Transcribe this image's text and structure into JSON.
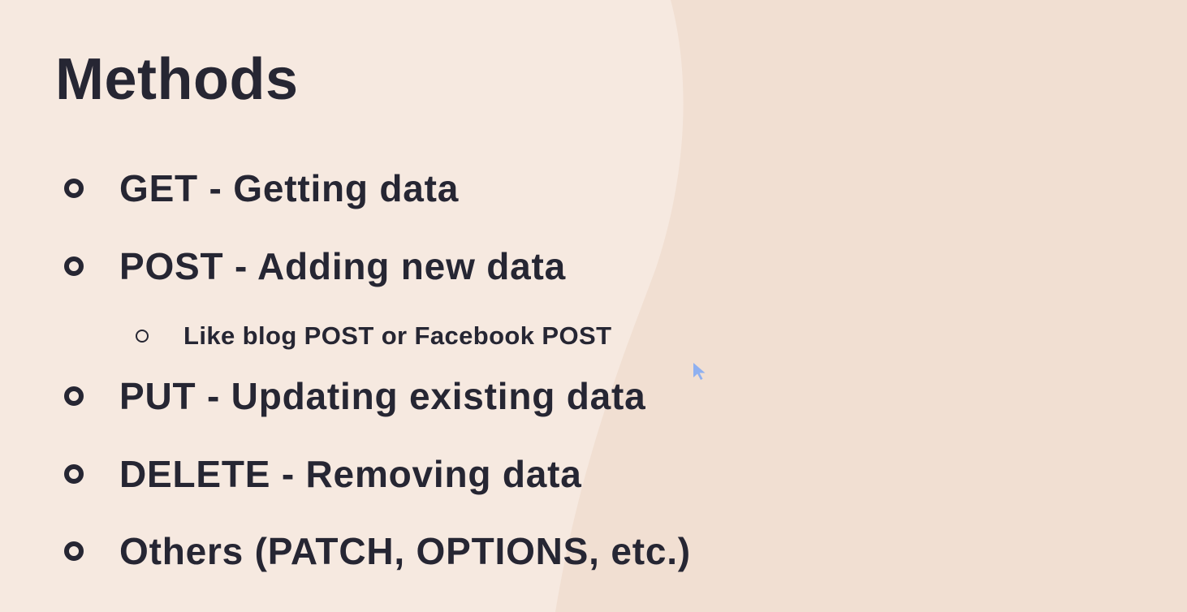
{
  "slide": {
    "title": "Methods",
    "items": [
      {
        "text": "GET - Getting data",
        "level": 1
      },
      {
        "text": "POST - Adding new data",
        "level": 1
      },
      {
        "text": "Like blog POST or Facebook POST",
        "level": 2
      },
      {
        "text": "PUT - Updating existing data",
        "level": 1
      },
      {
        "text": "DELETE - Removing data",
        "level": 1
      },
      {
        "text": "Others (PATCH, OPTIONS, etc.)",
        "level": 1
      }
    ]
  },
  "colors": {
    "background": "#f1dfd2",
    "background_light": "#f6e9e0",
    "text": "#262633",
    "cursor": "#8fb0f0"
  },
  "icons": {
    "bullet": "hollow-circle",
    "pointer": "mouse-pointer-icon"
  }
}
